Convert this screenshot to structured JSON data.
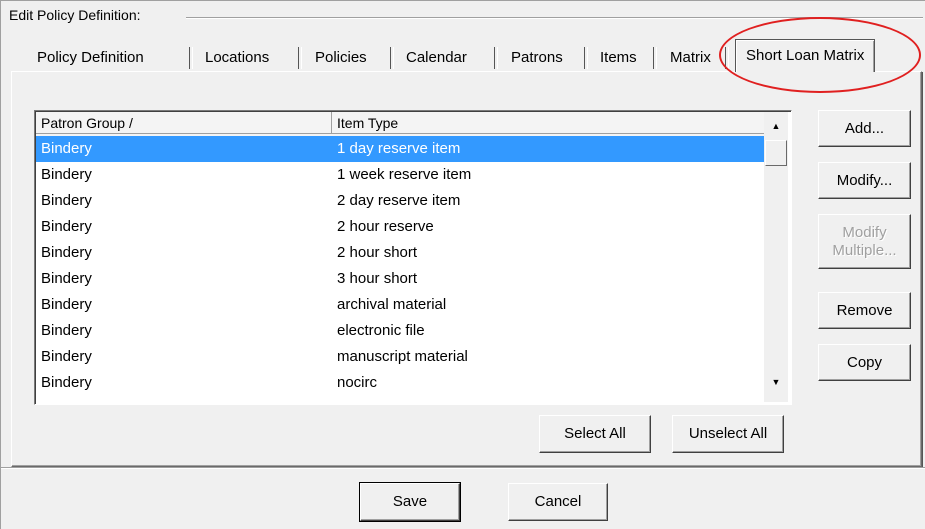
{
  "dialog": {
    "group_title": "Edit Policy Definition:"
  },
  "tabs": [
    {
      "label": "Policy Definition",
      "active": false
    },
    {
      "label": "Locations",
      "active": false
    },
    {
      "label": "Policies",
      "active": false
    },
    {
      "label": "Calendar",
      "active": false
    },
    {
      "label": "Patrons",
      "active": false
    },
    {
      "label": "Items",
      "active": false
    },
    {
      "label": "Matrix",
      "active": false
    },
    {
      "label": "Short Loan Matrix",
      "active": true
    }
  ],
  "table": {
    "columns": [
      "Patron Group /",
      "Item Type"
    ],
    "rows": [
      [
        "Bindery",
        "1 day reserve item"
      ],
      [
        "Bindery",
        "1 week reserve item"
      ],
      [
        "Bindery",
        "2 day reserve item"
      ],
      [
        "Bindery",
        "2 hour reserve"
      ],
      [
        "Bindery",
        "2 hour short"
      ],
      [
        "Bindery",
        "3 hour short"
      ],
      [
        "Bindery",
        "archival material"
      ],
      [
        "Bindery",
        "electronic file"
      ],
      [
        "Bindery",
        "manuscript material"
      ],
      [
        "Bindery",
        "nocirc"
      ]
    ],
    "selected_row": 0
  },
  "side_buttons": {
    "add": "Add...",
    "modify": "Modify...",
    "modify_multiple_line1": "Modify",
    "modify_multiple_line2": "Multiple...",
    "remove": "Remove",
    "copy": "Copy"
  },
  "select_buttons": {
    "select_all": "Select All",
    "unselect_all": "Unselect All"
  },
  "footer": {
    "save": "Save",
    "cancel": "Cancel"
  },
  "annotation": {
    "color": "#e02020"
  }
}
